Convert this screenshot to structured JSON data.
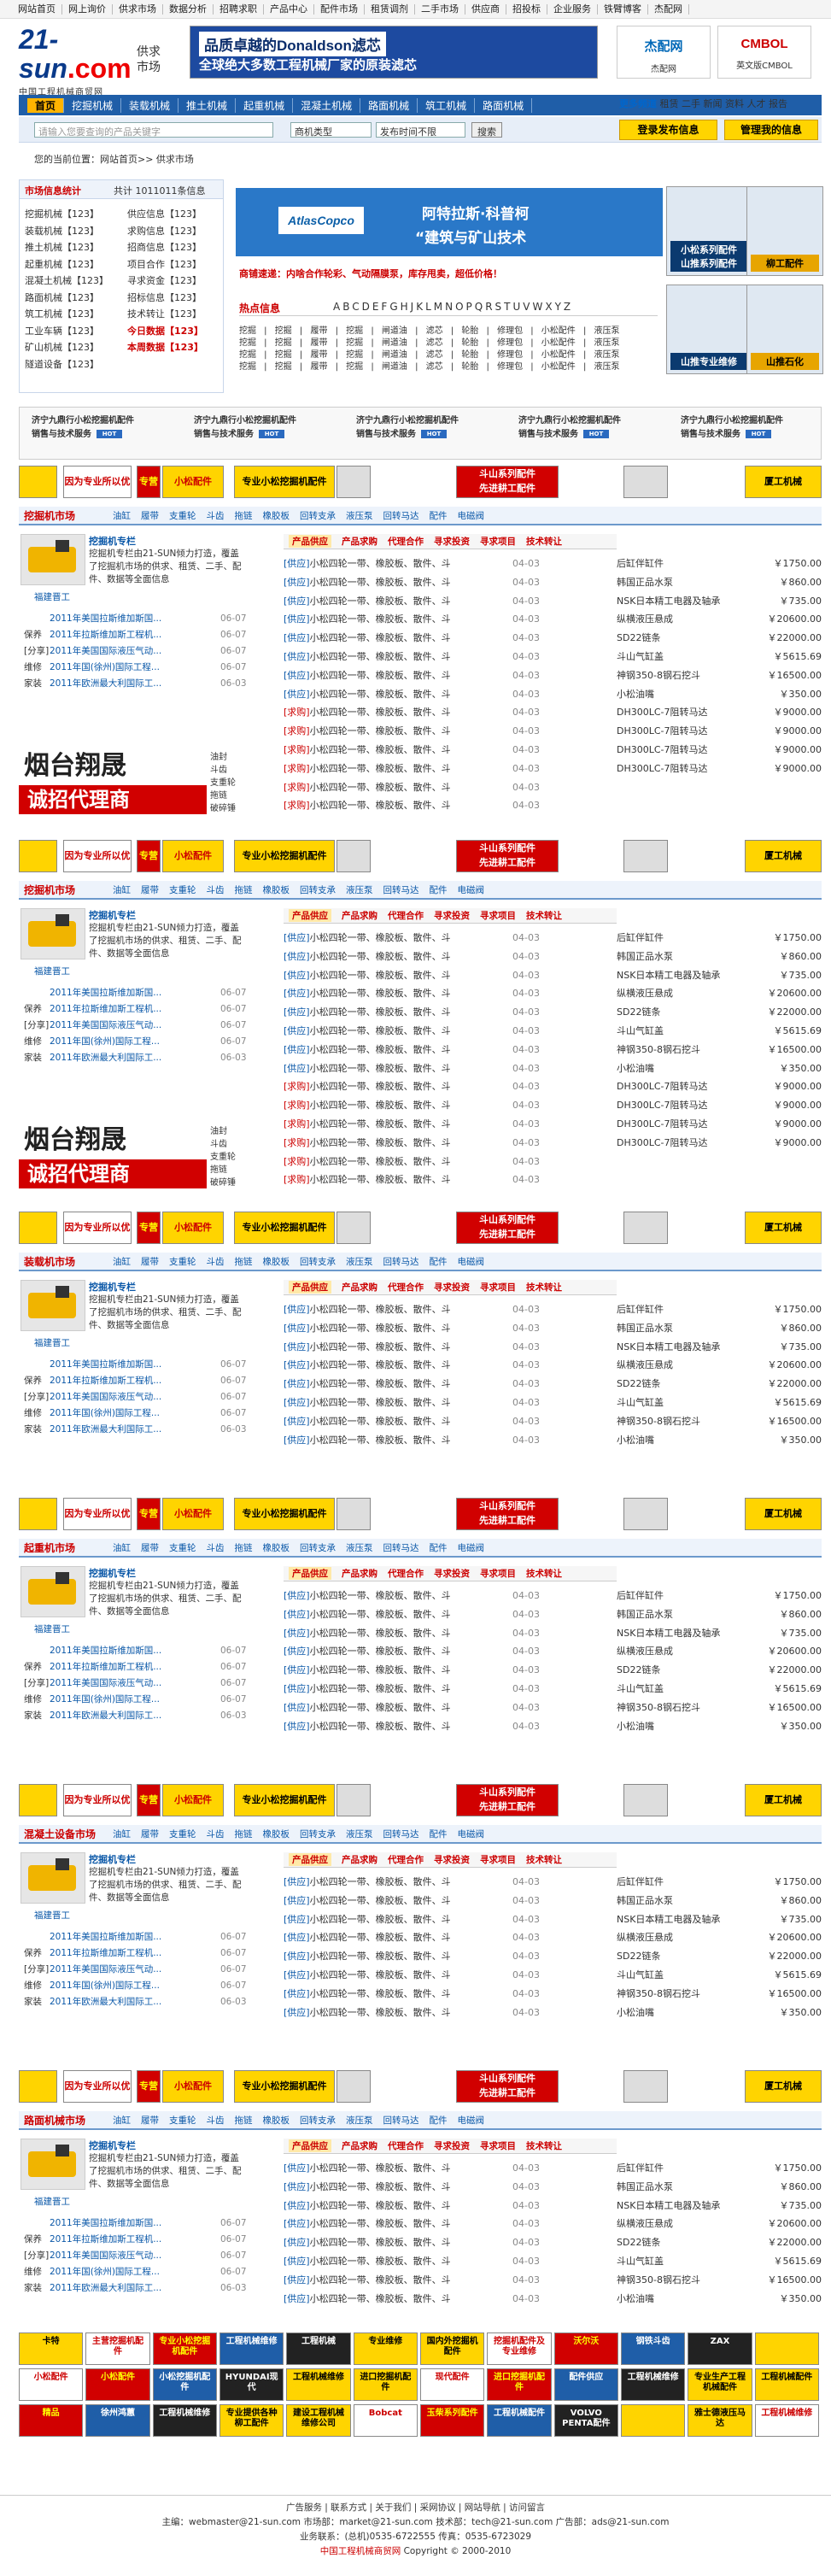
{
  "topnav": [
    "网站首页",
    "网上询价",
    "供求市场",
    "数据分析",
    "招聘求职",
    "产品中心",
    "配件市场",
    "租赁调剂",
    "二手市场",
    "供应商",
    "招投标",
    "企业服务",
    "铁臂博客",
    "杰配网"
  ],
  "header": {
    "logo_main": "21-sun",
    "logo_sub": ".com",
    "logo_cn": "中国工程机械商贸网",
    "channel": "供求市场",
    "ad_line1": "品质卓越的Donaldson滤芯",
    "ad_line2": "全球绝大多数工程机械厂家的原装滤芯",
    "logo1_name": "杰配网",
    "logo1_sub": "杰配网",
    "logo2_name": "CMBOL",
    "logo2_sub": "英文版CMBOL"
  },
  "mainnav": {
    "items": [
      "首页",
      "挖掘机械",
      "装载机械",
      "推土机械",
      "起重机械",
      "混凝土机械",
      "路面机械",
      "筑工机械",
      "路面机械"
    ],
    "more": "更多频道",
    "more_links": "租赁 二手 新闻 资料 人才 报告"
  },
  "search": {
    "placeholder": "请输入您要查询的产品关键字",
    "type": "商机类型",
    "time": "发布时间不限",
    "button": "搜索",
    "login_btn": "登录发布信息",
    "manage_btn": "管理我的信息"
  },
  "breadcrumb": "您的当前位置：网站首页>> 供求市场",
  "stats": {
    "title": "市场信息统计",
    "total": "共计 1011011条信息",
    "left": [
      "挖掘机械【123】",
      "装载机械【123】",
      "推土机械【123】",
      "起重机械【123】",
      "混凝土机械【123】",
      "路面机械【123】",
      "筑工机械【123】",
      "工业车辆【123】",
      "矿山机械【123】",
      "隧道设备【123】"
    ],
    "right": [
      "供应信息【123】",
      "求购信息【123】",
      "招商信息【123】",
      "项目合作【123】",
      "寻求资金【123】",
      "招标信息【123】",
      "技术转让【123】",
      "今日数据【123】",
      "本周数据【123】"
    ]
  },
  "atlas": {
    "logo": "AtlasCopco",
    "line1": "阿特拉斯·科普柯",
    "line2": "“建筑与矿山技术"
  },
  "scrolltext": "商铺速递：内啥合作轮彩、气动隔膜泵，库存甩卖，超低价格！",
  "hot": {
    "label": "热点信息",
    "letters": "ABCDEFGHJKLMNOPQRSTUVWXYZ",
    "kw_rows": [
      "挖掘 | 挖掘 | 履带 | 挖掘 | 闸道油 | 滤芯 | 轮胎 | 修理包 | 小松配件 | 液压泵",
      "挖掘 | 挖掘 | 履带 | 挖掘 | 闸道油 | 滤芯 | 轮胎 | 修理包 | 小松配件 | 液压泵",
      "挖掘 | 挖掘 | 履带 | 挖掘 | 闸道油 | 滤芯 | 轮胎 | 修理包 | 小松配件 | 液压泵",
      "挖掘 | 挖掘 | 履带 | 挖掘 | 闸道油 | 滤芯 | 轮胎 | 修理包 | 小松配件 | 液压泵"
    ]
  },
  "side_ads": [
    "小松系列配件\n山推系列配件",
    "柳工配件",
    "山推专业维修",
    "山推石化"
  ],
  "strip": [
    "济宁九鼎行小松挖掘机配件\n销售与技术服务",
    "济宁九鼎行小松挖掘机配件\n销售与技术服务",
    "济宁九鼎行小松挖掘机配件\n销售与技术服务",
    "济宁九鼎行小松挖掘机配件\n销售与技术服务",
    "济宁九鼎行小松挖掘机配件\n销售与技术服务"
  ],
  "ads": [
    "",
    "因为专业所以优秀",
    "专营",
    "小松配件",
    "专业小松挖掘机配件",
    "",
    "斗山系列配件\n先进耕工配件",
    "",
    "厦工机械"
  ],
  "tabs": [
    "产品供应",
    "产品求购",
    "代理合作",
    "寻求投资",
    "寻求项目",
    "技术转让"
  ],
  "tags": [
    "油缸",
    "履带",
    "支重轮",
    "斗齿",
    "拖链",
    "橡胶板",
    "回转支承",
    "液压泵",
    "回转马达",
    "配件",
    "电磁阀"
  ],
  "sections": [
    {
      "title": "挖掘机市场"
    },
    {
      "title": "挖掘机市场"
    },
    {
      "title": "装载机市场"
    },
    {
      "title": "起重机市场"
    },
    {
      "title": "混凝土设备市场"
    },
    {
      "title": "路面机械市场"
    }
  ],
  "left": {
    "ptitle": "挖掘机专栏",
    "pdesc": "挖掘机专栏由21-SUN倾力打造，覆盖了挖掘机市场的供求、租赁、二手、配件、数据等全面信息",
    "pname": "福建晋工",
    "news": [
      {
        "k": "",
        "t": "2011年美国拉斯维加斯国...",
        "d": "06-07"
      },
      {
        "k": "保养",
        "t": "2011年拉斯维加斯工程机...",
        "d": "06-07"
      },
      {
        "k": "[分享]",
        "t": "2011年美国国际液压气动...",
        "d": "06-07"
      },
      {
        "k": "维修",
        "t": "2011年国(徐州)国际工程...",
        "d": "06-07"
      },
      {
        "k": "家装",
        "t": "2011年欧洲最大利国际工...",
        "d": "06-03"
      }
    ]
  },
  "yantai": {
    "a": "烟台翔晟",
    "b": "诚招代理商",
    "side": "油封\n斗齿\n支重轮\n拖链\n破碎锤"
  },
  "rows": [
    {
      "tag": "[供应]",
      "buy": false,
      "text": "小松四轮一带、橡胶板、散件、斗",
      "date": "04-03"
    },
    {
      "tag": "[供应]",
      "buy": false,
      "text": "小松四轮一带、橡胶板、散件、斗",
      "date": "04-03"
    },
    {
      "tag": "[供应]",
      "buy": false,
      "text": "小松四轮一带、橡胶板、散件、斗",
      "date": "04-03"
    },
    {
      "tag": "[供应]",
      "buy": false,
      "text": "小松四轮一带、橡胶板、散件、斗",
      "date": "04-03"
    },
    {
      "tag": "[供应]",
      "buy": false,
      "text": "小松四轮一带、橡胶板、散件、斗",
      "date": "04-03"
    },
    {
      "tag": "[供应]",
      "buy": false,
      "text": "小松四轮一带、橡胶板、散件、斗",
      "date": "04-03"
    },
    {
      "tag": "[供应]",
      "buy": false,
      "text": "小松四轮一带、橡胶板、散件、斗",
      "date": "04-03"
    },
    {
      "tag": "[供应]",
      "buy": false,
      "text": "小松四轮一带、橡胶板、散件、斗",
      "date": "04-03"
    },
    {
      "tag": "[求购]",
      "buy": true,
      "text": "小松四轮一带、橡胶板、散件、斗",
      "date": "04-03"
    },
    {
      "tag": "[求购]",
      "buy": true,
      "text": "小松四轮一带、橡胶板、散件、斗",
      "date": "04-03"
    },
    {
      "tag": "[求购]",
      "buy": true,
      "text": "小松四轮一带、橡胶板、散件、斗",
      "date": "04-03"
    },
    {
      "tag": "[求购]",
      "buy": true,
      "text": "小松四轮一带、橡胶板、散件、斗",
      "date": "04-03"
    },
    {
      "tag": "[求购]",
      "buy": true,
      "text": "小松四轮一带、橡胶板、散件、斗",
      "date": "04-03"
    },
    {
      "tag": "[求购]",
      "buy": true,
      "text": "小松四轮一带、橡胶板、散件、斗",
      "date": "04-03"
    }
  ],
  "prices": [
    {
      "n": "后缸伴缸件",
      "p": "￥1750.00"
    },
    {
      "n": "韩国正品水泵",
      "p": "￥860.00"
    },
    {
      "n": "NSK日本精工电器及轴承",
      "p": "￥735.00"
    },
    {
      "n": "纵横液压悬成",
      "p": "￥20600.00"
    },
    {
      "n": "SD22链条",
      "p": "￥22000.00"
    },
    {
      "n": "斗山气缸盖",
      "p": "￥5615.69"
    },
    {
      "n": "神钢350-8钢石挖斗",
      "p": "￥16500.00"
    },
    {
      "n": "小松油嘴",
      "p": "￥350.00"
    },
    {
      "n": "DH300LC-7阻转马达",
      "p": "￥9000.00"
    },
    {
      "n": "DH300LC-7阻转马达",
      "p": "￥9000.00"
    },
    {
      "n": "DH300LC-7阻转马达",
      "p": "￥9000.00"
    },
    {
      "n": "DH300LC-7阻转马达",
      "p": "￥9000.00"
    }
  ],
  "grid": [
    "卡特",
    "主营挖掘机配件",
    "专业小松挖掘机配件",
    "工程机械维修",
    "工程机械",
    "专业维修",
    "国内外挖掘机配件",
    "挖掘机配件及专业维修",
    "沃尔沃",
    "钢铁斗齿",
    "ZAX",
    "",
    "小松配件",
    "小松配件",
    "小松挖掘机配件",
    "HYUNDAI现代",
    "工程机械维修",
    "进口挖掘机配件",
    "现代配件",
    "进口挖掘机配件",
    "配件供应",
    "工程机械维修",
    "专业生产工程机械配件",
    "工程机械配件",
    "精品",
    "徐州鸿蕙",
    "工程机械维修",
    "专业提供各种柳工配件",
    "建设工程机械维修公司",
    "Bobcat",
    "玉柴系列配件",
    "工程机械配件",
    "VOLVO PENTA配件",
    "",
    "雅士德液压马达",
    "工程机械维修"
  ],
  "footer": {
    "links": "广告服务 | 联系方式 | 关于我们 | 采网协议 | 网站导航 | 访问留言",
    "contact": "主编：webmaster@21-sun.com  市场部：market@21-sun.com  技术部：tech@21-sun.com  广告部：ads@21-sun.com",
    "phone": "业务联系：(总机)0535-6722555  传真：0535-6723029",
    "copy": "中国工程机械商贸网",
    "copy2": "Copyright © 2000-2010"
  }
}
